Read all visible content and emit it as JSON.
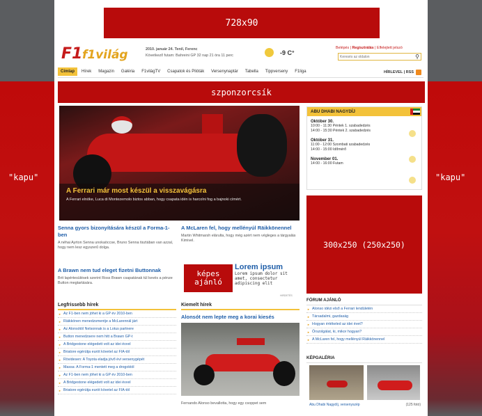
{
  "ads": {
    "top": "728x90",
    "sponsor": "szponzorcsík",
    "left": "\"kapu\"",
    "right": "\"kapu\"",
    "mid": "300x250 (250x250)",
    "small_ad": "képes\najánló",
    "lorem_title": "Lorem ipsum",
    "lorem_text": "Lorem ipsum dolor sit amet, consectetur adipiscing elit",
    "hirdetes": "HIRDETÉS"
  },
  "header": {
    "logo": "f1világ",
    "date": "2010. január 24. Tenil, Ferenc",
    "race": "Következő futam: Bahreini GP 32 nap 21 óra 11 perc",
    "temp": "-9 C°",
    "login": "Belépés",
    "register": "Regisztrálás",
    "forgot": "Elfelejtett jelszó",
    "search_placeholder": "Keresés az oldalon"
  },
  "nav": {
    "items": [
      "Címlap",
      "Hírek",
      "Magazin",
      "Galéria",
      "F1világTV",
      "Csapatok és Pilóták",
      "Versenynaptár",
      "Tabella",
      "Tippverseny",
      "F1liga"
    ],
    "right": "HÍRLEVEL | RSS"
  },
  "hero": {
    "title": "A Ferrari már most készül a visszavágásra",
    "text": "A Ferrari elnöke, Luca di Montezemolo biztos abban, hogy csapata idén is harcolni fog a bajnoki címért."
  },
  "articles": [
    {
      "title": "Senna gyors bizonyítására készül a Forma-1-ben",
      "text": "A néhai Ayrton Senna unokaöccse, Bruno Senna tisztában van azzal, hogy nem lesz egyszerű dolga."
    },
    {
      "title": "A McLaren fel, hogy mellényúl Räikkönennel",
      "text": "Martin Whitmarsh elárulta, hogy még azért nem végleges a tárgyalás Kimivel."
    },
    {
      "title": "A Brawn nem tud eleget fizetni Buttonnak",
      "text": "Brit lapértesülések szerint Ross Brawn csapatának túl kevés a pénze Button megtartására."
    }
  ],
  "popular": {
    "title": "Legfrissebb hírek",
    "items": [
      "Az F1-ben nem jöhet ki a GP év 2010-ben",
      "Räikkönen menedzsmentje a McLarennál járt",
      "Az Alonsótól Nelsonnak is a Lotus partnere",
      "Button menedzsere nem hitt a Brawn GP-t",
      "A Bridgestone elégedett volt az idei évvel",
      "Briatore egérútja eurót követel az FIA-tól",
      "Rövidesen: A Toyota eladja jövő évi versenygépét",
      "Massa: A Forma-1 mentett meg a drogoktól",
      "Az F1-ben nem jöhet ki a GP év 2010-ben",
      "A Bridgestone elégedett volt az idei évvel",
      "Briatore egérútja eurót követel az FIA-tól"
    ]
  },
  "featured": {
    "title": "Kiemelt hírek",
    "headline": "Alonsót nem lepte meg a korai kiesés",
    "text": "Fernando Alonso bevallotta, hogy egy csoppet sem"
  },
  "schedule": {
    "title": "ABU DHABI NAGYDÍJ",
    "days": [
      {
        "date": "Október 30.",
        "rows": [
          "10:00 - 11:30 Péntek 1. szabadedzés",
          "14:00 - 15:30 Péntek 2. szabadedzés"
        ]
      },
      {
        "date": "Október 31.",
        "rows": [
          "11:00 - 12:00 Szombati szabadedzés",
          "14:00 - 15:00 Időmérő"
        ]
      },
      {
        "date": "November 01.",
        "rows": [
          "14:00 - 16:00 Futam"
        ]
      }
    ]
  },
  "forum": {
    "title": "FÓRUM AJÁNLÓ",
    "items": [
      "Alonso idézi első a Ferrari lendületén",
      "Társadalmi, gazdaság",
      "Hogyan értékeled az idei évet?",
      "Őrszolgálat, ki, mikor hogyan?",
      "A McLaren fel, hogy mellényúl Räikkönennel"
    ]
  },
  "gallery": {
    "title": "KÉPGALÉRIA",
    "caption": "Abu Dhabi Nagydíj, versenyszép",
    "count": "(125 fotó)"
  }
}
